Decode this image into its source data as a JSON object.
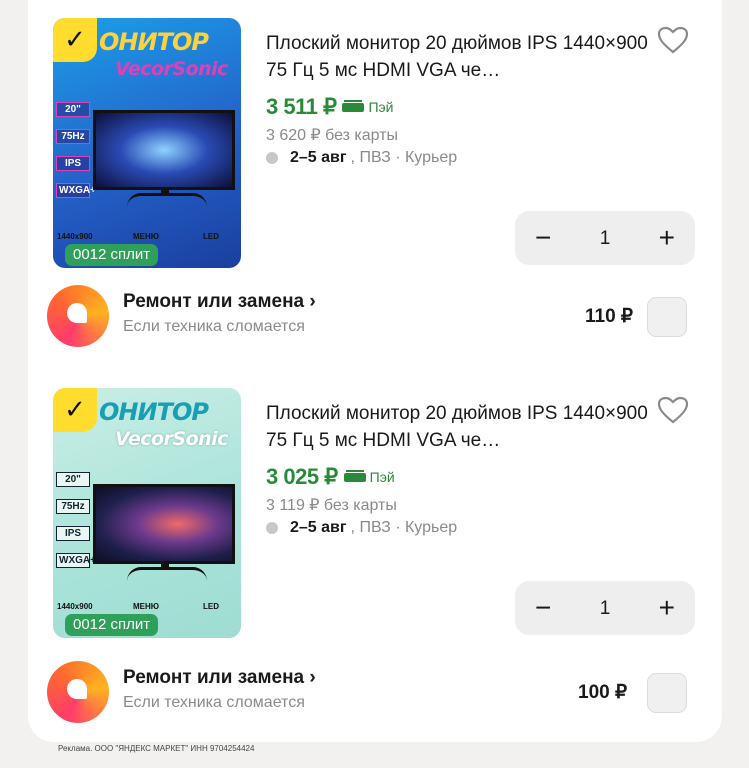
{
  "products": [
    {
      "image": {
        "brand_line1": "ОНИТОР",
        "brand_line2": "VecorSonic",
        "specs": [
          "20\"",
          "75Hz",
          "IPS",
          "WXGA+"
        ],
        "bottom_labels": [
          "1440x900",
          "МЕНЮ",
          "LED"
        ],
        "split_label": "0012 сплит",
        "theme": "blue"
      },
      "title": "Плоский монитор 20 дюймов IPS 1440×900 75 Гц 5 мс HDMI VGA че…",
      "price": "3 511 ₽",
      "pay_label": "Пэй",
      "old_price": "3 620 ₽ без карты",
      "delivery_dates": "2–5 авг",
      "delivery_rest": ", ПВЗ · Курьер",
      "quantity": "1",
      "minus": "−",
      "plus": "+"
    },
    {
      "image": {
        "brand_line1": "ОНИТОР",
        "brand_line2": "VecorSonic",
        "specs": [
          "20\"",
          "75Hz",
          "IPS",
          "WXGA+"
        ],
        "bottom_labels": [
          "1440x900",
          "МЕНЮ",
          "LED"
        ],
        "split_label": "0012 сплит",
        "theme": "mint"
      },
      "title": "Плоский монитор 20 дюймов IPS 1440×900 75 Гц 5 мс HDMI VGA че…",
      "price": "3 025 ₽",
      "pay_label": "Пэй",
      "old_price": "3 119 ₽ без карты",
      "delivery_dates": "2–5 авг",
      "delivery_rest": ", ПВЗ · Курьер",
      "quantity": "1",
      "minus": "−",
      "plus": "+"
    }
  ],
  "services": [
    {
      "title": "Ремонт или замена ›",
      "subtitle": "Если техника сломается",
      "price": "110 ₽"
    },
    {
      "title": "Ремонт или замена ›",
      "subtitle": "Если техника сломается",
      "price": "100 ₽"
    }
  ],
  "ad_footer": "Реклама. ООО \"ЯНДЕКС МАРКЕТ\" ИНН 9704254424",
  "colors": {
    "price_green": "#2a8a3a",
    "checkbox_yellow": "#ffdc2e",
    "split_green": "#2fa05a"
  }
}
